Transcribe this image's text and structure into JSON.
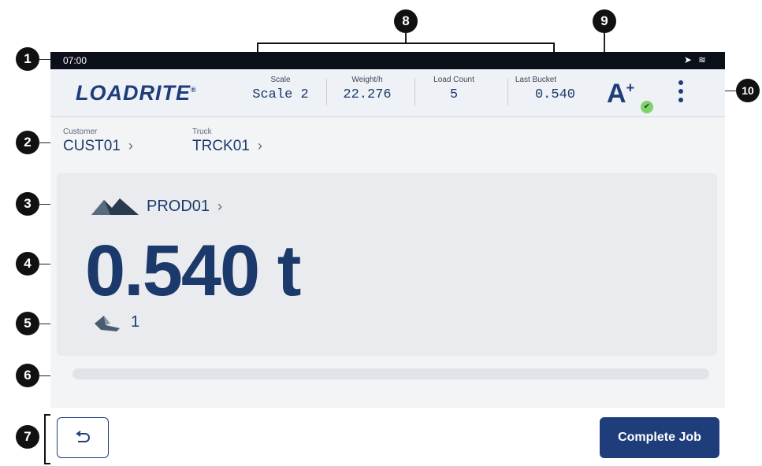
{
  "status_bar": {
    "time": "07:00",
    "icons": [
      "location-arrow-icon",
      "wifi-icon"
    ]
  },
  "header": {
    "logo": "LOADRITE",
    "stats": [
      {
        "label": "Scale",
        "value": "Scale 2"
      },
      {
        "label": "Weight/h",
        "value": "22.276"
      },
      {
        "label": "Load Count",
        "value": "5"
      },
      {
        "label": "Last Bucket",
        "value": "0.540"
      }
    ],
    "badge": "A",
    "badge_sup": "+"
  },
  "fields": {
    "customer": {
      "label": "Customer",
      "value": "CUST01"
    },
    "truck": {
      "label": "Truck",
      "value": "TRCK01"
    }
  },
  "card": {
    "product": "PROD01",
    "weight": "0.540 t",
    "bucket_count": "1"
  },
  "footer": {
    "complete_label": "Complete Job"
  },
  "callouts": [
    "1",
    "2",
    "3",
    "4",
    "5",
    "6",
    "7",
    "8",
    "9",
    "10"
  ],
  "colors": {
    "brand": "#1f3d7a",
    "status_bg": "#0b0f1a",
    "check": "#7fd36a"
  }
}
